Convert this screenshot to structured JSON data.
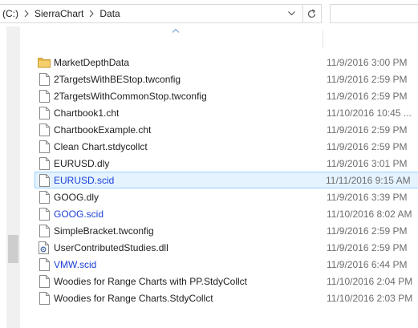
{
  "breadcrumb": {
    "items": [
      "(C:)",
      "SierraChart",
      "Data"
    ]
  },
  "search": {
    "placeholder": ""
  },
  "files": [
    {
      "name": "MarketDepthData",
      "date": "11/9/2016 3:00 PM",
      "type": "folder",
      "compressed": false,
      "selected": false
    },
    {
      "name": "2TargetsWithBEStop.twconfig",
      "date": "11/9/2016 2:59 PM",
      "type": "file",
      "compressed": false,
      "selected": false
    },
    {
      "name": "2TargetsWithCommonStop.twconfig",
      "date": "11/9/2016 2:59 PM",
      "type": "file",
      "compressed": false,
      "selected": false
    },
    {
      "name": "Chartbook1.cht",
      "date": "11/10/2016 10:45 ...",
      "type": "file",
      "compressed": false,
      "selected": false
    },
    {
      "name": "ChartbookExample.cht",
      "date": "11/9/2016 2:59 PM",
      "type": "file",
      "compressed": false,
      "selected": false
    },
    {
      "name": "Clean Chart.stdycollct",
      "date": "11/9/2016 2:59 PM",
      "type": "file",
      "compressed": false,
      "selected": false
    },
    {
      "name": "EURUSD.dly",
      "date": "11/9/2016 3:01 PM",
      "type": "file",
      "compressed": false,
      "selected": false
    },
    {
      "name": "EURUSD.scid",
      "date": "11/11/2016 9:15 AM",
      "type": "file",
      "compressed": true,
      "selected": true
    },
    {
      "name": "GOOG.dly",
      "date": "11/9/2016 3:39 PM",
      "type": "file",
      "compressed": false,
      "selected": false
    },
    {
      "name": "GOOG.scid",
      "date": "11/10/2016 8:02 AM",
      "type": "file",
      "compressed": true,
      "selected": false
    },
    {
      "name": "SimpleBracket.twconfig",
      "date": "11/9/2016 2:59 PM",
      "type": "file",
      "compressed": false,
      "selected": false
    },
    {
      "name": "UserContributedStudies.dll",
      "date": "11/9/2016 2:59 PM",
      "type": "dll",
      "compressed": false,
      "selected": false
    },
    {
      "name": "VMW.scid",
      "date": "11/9/2016 6:44 PM",
      "type": "file",
      "compressed": true,
      "selected": false
    },
    {
      "name": "Woodies for Range Charts with PP.StdyCollct",
      "date": "11/10/2016 2:04 PM",
      "type": "file",
      "compressed": false,
      "selected": false
    },
    {
      "name": "Woodies for Range Charts.StdyCollct",
      "date": "11/10/2016 2:03 PM",
      "type": "file",
      "compressed": false,
      "selected": false
    }
  ],
  "colors": {
    "selection_bg": "#e5f3ff",
    "selection_border": "#99d1ff",
    "compressed_text": "#1a3fd6",
    "folder": "#e8b84a"
  }
}
